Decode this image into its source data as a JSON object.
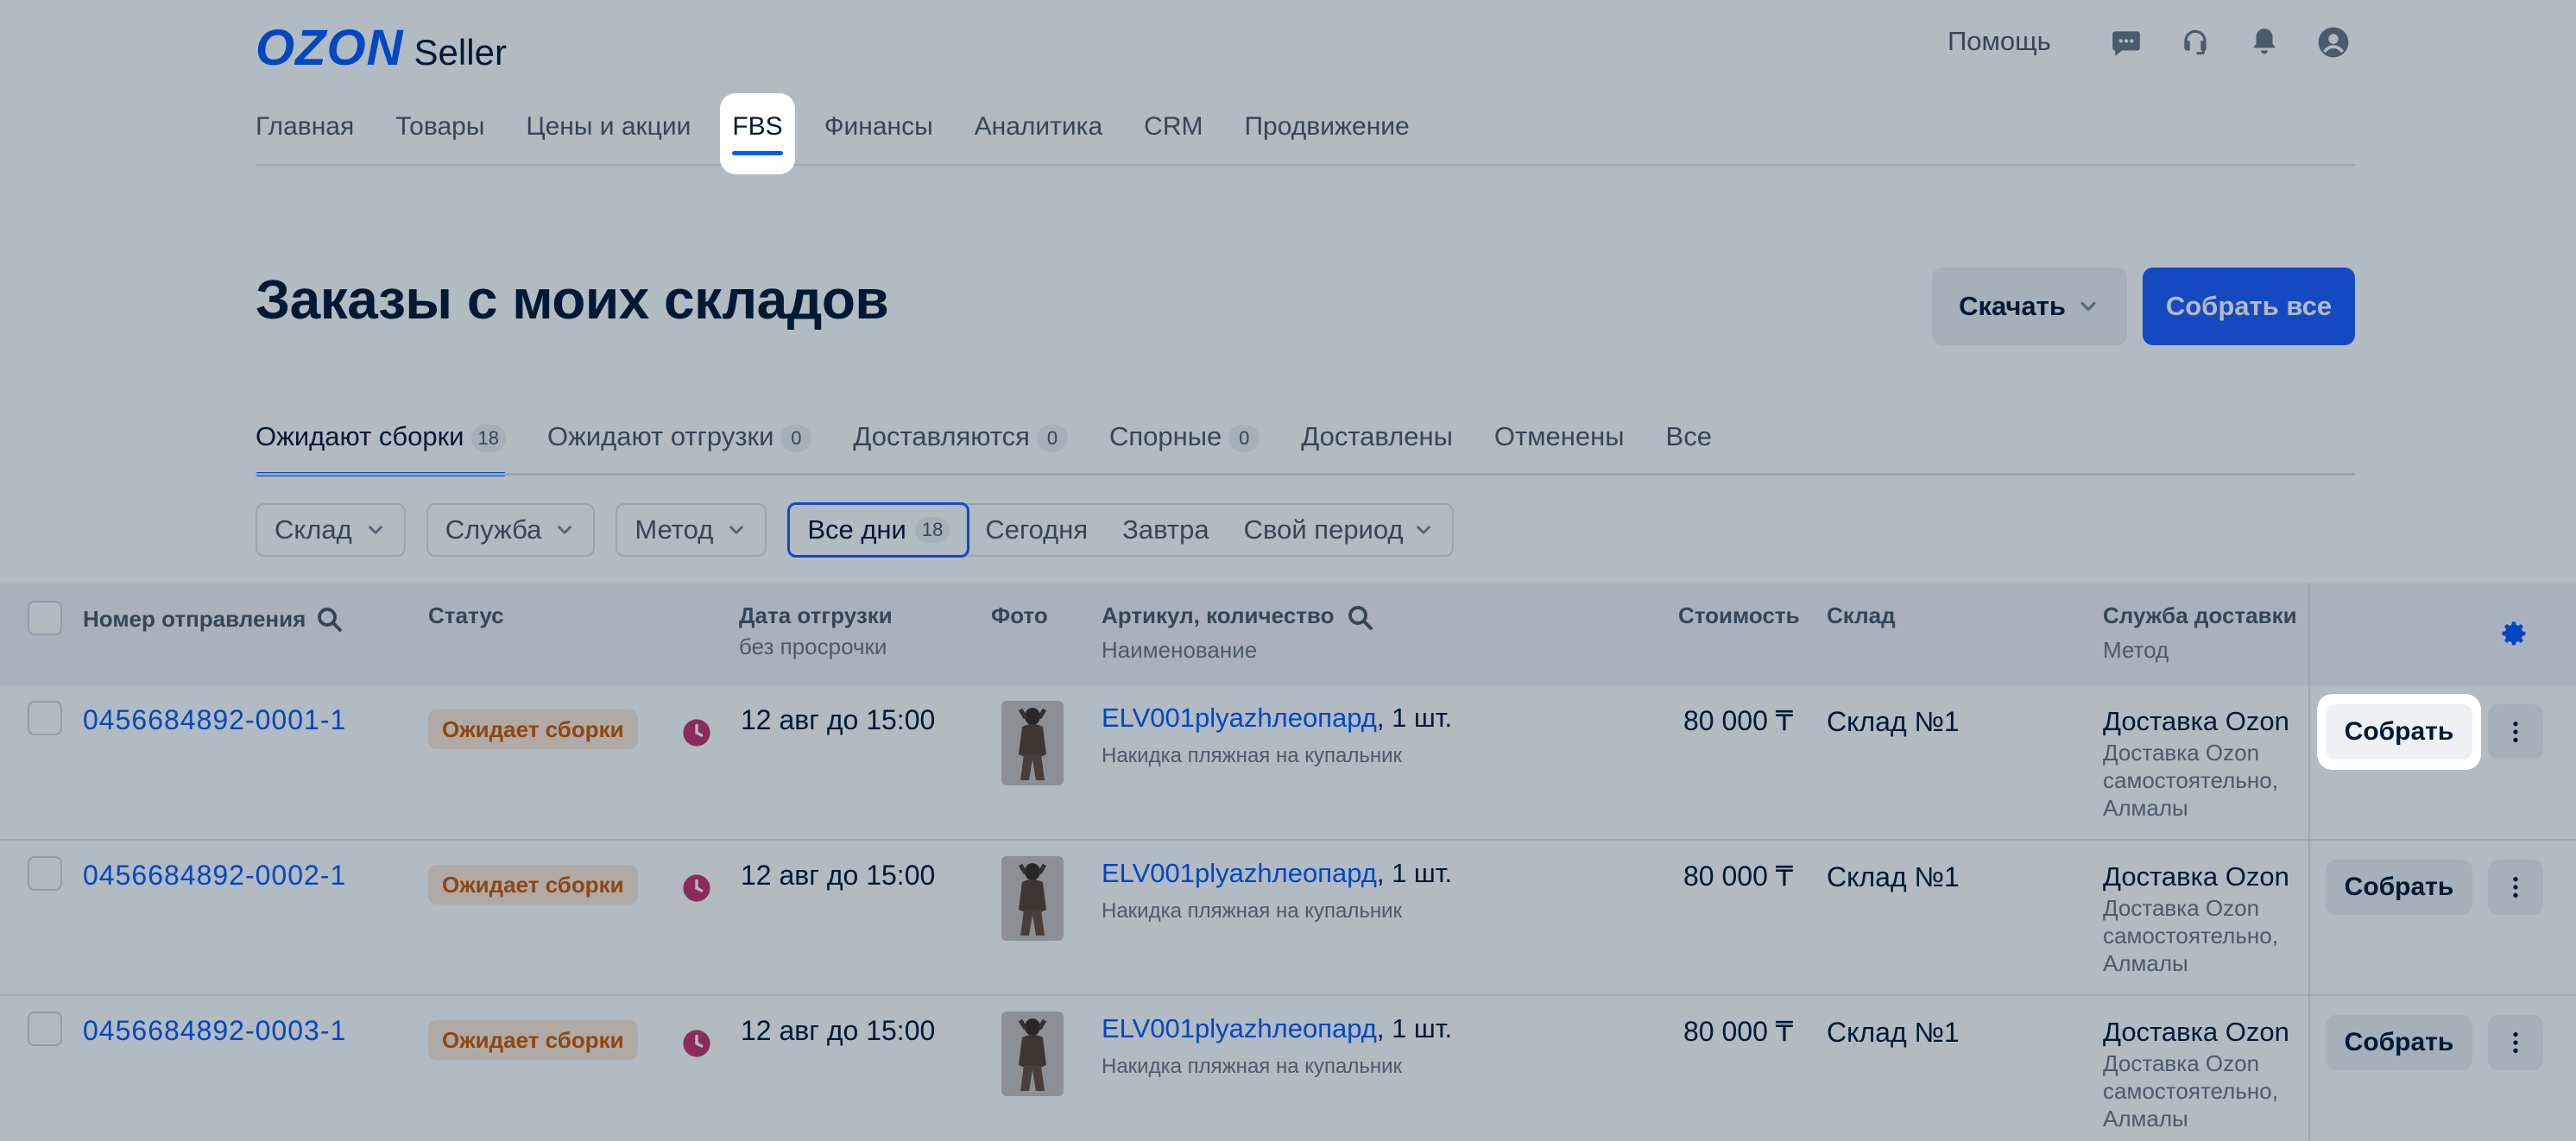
{
  "header": {
    "logo_main": "OZON",
    "logo_sub": "Seller",
    "help_label": "Помощь",
    "icons": [
      "chat-icon",
      "headset-icon",
      "bell-icon",
      "profile-icon"
    ]
  },
  "nav": {
    "items": [
      {
        "label": "Главная"
      },
      {
        "label": "Товары"
      },
      {
        "label": "Цены и акции"
      },
      {
        "label": "FBS",
        "active": true
      },
      {
        "label": "Финансы"
      },
      {
        "label": "Аналитика"
      },
      {
        "label": "CRM"
      },
      {
        "label": "Продвижение"
      }
    ]
  },
  "page": {
    "title": "Заказы с моих складов",
    "download_label": "Скачать",
    "collect_all_label": "Собрать все"
  },
  "tabs": [
    {
      "label": "Ожидают сборки",
      "count": "18",
      "active": true
    },
    {
      "label": "Ожидают отгрузки",
      "count": "0"
    },
    {
      "label": "Доставляются",
      "count": "0"
    },
    {
      "label": "Спорные",
      "count": "0"
    },
    {
      "label": "Доставлены"
    },
    {
      "label": "Отменены"
    },
    {
      "label": "Все"
    }
  ],
  "filters": {
    "warehouse": "Склад",
    "service": "Служба",
    "method": "Метод",
    "periods": [
      {
        "label": "Все дни",
        "count": "18",
        "active": true
      },
      {
        "label": "Сегодня"
      },
      {
        "label": "Завтра"
      },
      {
        "label": "Свой период"
      }
    ]
  },
  "table": {
    "headers": {
      "order": "Номер отправления",
      "status": "Статус",
      "ship_date": "Дата отгрузки",
      "ship_date_sub": "без просрочки",
      "photo": "Фото",
      "sku": "Артикул, количество",
      "sku_sub": "Наименование",
      "price": "Стоимость",
      "warehouse": "Склад",
      "delivery": "Служба доставки",
      "delivery_sub": "Метод"
    },
    "rows": [
      {
        "order": "0456684892-0001-1",
        "status": "Ожидает сборки",
        "ship_date": "12 авг до 15:00",
        "sku": "ELV001plyazhлеопард",
        "qty": ", 1 шт.",
        "name": "Накидка пляжная на купальник",
        "price": "80 000 ₸",
        "warehouse": "Склад №1",
        "delivery": "Доставка Ozon",
        "delivery_method": "Доставка Ozon самостоятельно, Алмалы",
        "action": "Собрать"
      },
      {
        "order": "0456684892-0002-1",
        "status": "Ожидает сборки",
        "ship_date": "12 авг до 15:00",
        "sku": "ELV001plyazhлеопард",
        "qty": ", 1 шт.",
        "name": "Накидка пляжная на купальник",
        "price": "80 000 ₸",
        "warehouse": "Склад №1",
        "delivery": "Доставка Ozon",
        "delivery_method": "Доставка Ozon самостоятельно, Алмалы",
        "action": "Собрать"
      },
      {
        "order": "0456684892-0003-1",
        "status": "Ожидает сборки",
        "ship_date": "12 авг до 15:00",
        "sku": "ELV001plyazhлеопард",
        "qty": ", 1 шт.",
        "name": "Накидка пляжная на купальник",
        "price": "80 000 ₸",
        "warehouse": "Склад №1",
        "delivery": "Доставка Ozon",
        "delivery_method": "Доставка Ozon самостоятельно, Алмалы",
        "action": "Собрать"
      }
    ]
  },
  "colors": {
    "accent": "#005bff",
    "status_bg": "#fbe9d7",
    "status_text": "#d05a00",
    "clock": "#c8336e"
  }
}
